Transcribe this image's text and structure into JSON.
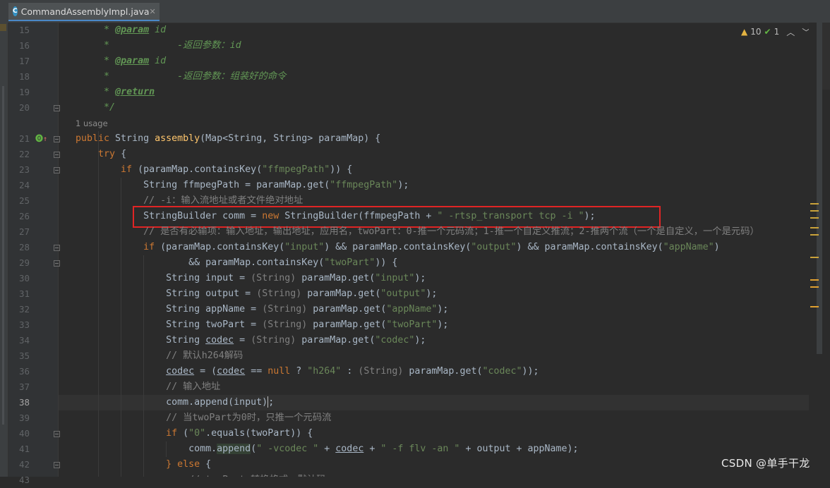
{
  "tab": {
    "icon": "C",
    "title": "CommandAssemblyImpl.java"
  },
  "inspection": {
    "warnings": "10",
    "ok": "1"
  },
  "editor": {
    "usage": "1 usage",
    "current_line": "38",
    "lines": [
      {
        "n": "15",
        "tokens": [
          [
            "    ",
            ""
          ],
          [
            " * ",
            "doc"
          ],
          [
            "@param",
            "tag"
          ],
          [
            " id",
            "doc"
          ]
        ]
      },
      {
        "n": "16",
        "tokens": [
          [
            "     *            -返回参数：id",
            "doc"
          ]
        ]
      },
      {
        "n": "17",
        "tokens": [
          [
            "    ",
            ""
          ],
          [
            " * ",
            "doc"
          ],
          [
            "@param",
            "tag"
          ],
          [
            " id",
            "doc"
          ]
        ]
      },
      {
        "n": "18",
        "tokens": [
          [
            "     *            -返回参数：组装好的命令",
            "doc"
          ]
        ]
      },
      {
        "n": "19",
        "tokens": [
          [
            "    ",
            ""
          ],
          [
            " * ",
            "doc"
          ],
          [
            "@return",
            "tag"
          ]
        ]
      },
      {
        "n": "20",
        "tokens": [
          [
            "     */",
            "doc"
          ]
        ]
      },
      {
        "n": "21",
        "tokens": [
          [
            "public ",
            "kw"
          ],
          [
            "String ",
            ""
          ],
          [
            "assembly",
            "fn"
          ],
          [
            "(Map<String, String> paramMap) {",
            ""
          ]
        ]
      },
      {
        "n": "22",
        "tokens": [
          [
            "    ",
            ""
          ],
          [
            "try ",
            "kw"
          ],
          [
            "{",
            ""
          ]
        ]
      },
      {
        "n": "23",
        "tokens": [
          [
            "        ",
            ""
          ],
          [
            "if ",
            "kw"
          ],
          [
            "(paramMap.containsKey(",
            ""
          ],
          [
            "\"ffmpegPath\"",
            "str"
          ],
          [
            ")) {",
            ""
          ]
        ]
      },
      {
        "n": "24",
        "tokens": [
          [
            "            String ffmpegPath = paramMap.get(",
            ""
          ],
          [
            "\"ffmpegPath\"",
            "str"
          ],
          [
            ");",
            ""
          ]
        ]
      },
      {
        "n": "25",
        "tokens": [
          [
            "            ",
            ""
          ],
          [
            "// -i：输入流地址或者文件绝对地址",
            "cm"
          ]
        ]
      },
      {
        "n": "26",
        "tokens": [
          [
            "            StringBuilder comm = ",
            ""
          ],
          [
            "new ",
            "kw"
          ],
          [
            "StringBuilder(ffmpegPath + ",
            ""
          ],
          [
            "\" -rtsp_transport tcp -i \"",
            "str"
          ],
          [
            ");",
            ""
          ]
        ]
      },
      {
        "n": "27",
        "tokens": [
          [
            "            ",
            ""
          ],
          [
            "// 是否有必输项：输入地址，输出地址，应用名，twoPart：0-推一个元码流；1-推一个自定义推流；2-推两个流（一个是自定义，一个是元码）",
            "cm"
          ]
        ]
      },
      {
        "n": "28",
        "tokens": [
          [
            "            ",
            ""
          ],
          [
            "if ",
            "kw"
          ],
          [
            "(paramMap.containsKey(",
            ""
          ],
          [
            "\"input\"",
            "str"
          ],
          [
            ") && paramMap.containsKey(",
            ""
          ],
          [
            "\"output\"",
            "str"
          ],
          [
            ") && paramMap.containsKey(",
            ""
          ],
          [
            "\"appName\"",
            "str"
          ],
          [
            ")",
            ""
          ]
        ]
      },
      {
        "n": "29",
        "tokens": [
          [
            "                    && paramMap.containsKey(",
            ""
          ],
          [
            "\"twoPart\"",
            "str"
          ],
          [
            ")) {",
            ""
          ]
        ]
      },
      {
        "n": "30",
        "tokens": [
          [
            "                String input = ",
            ""
          ],
          [
            "(String) ",
            "cast"
          ],
          [
            "paramMap.get(",
            ""
          ],
          [
            "\"input\"",
            "str"
          ],
          [
            ");",
            ""
          ]
        ]
      },
      {
        "n": "31",
        "tokens": [
          [
            "                String output = ",
            ""
          ],
          [
            "(String) ",
            "cast"
          ],
          [
            "paramMap.get(",
            ""
          ],
          [
            "\"output\"",
            "str"
          ],
          [
            ");",
            ""
          ]
        ]
      },
      {
        "n": "32",
        "tokens": [
          [
            "                String appName = ",
            ""
          ],
          [
            "(String) ",
            "cast"
          ],
          [
            "paramMap.get(",
            ""
          ],
          [
            "\"appName\"",
            "str"
          ],
          [
            ");",
            ""
          ]
        ]
      },
      {
        "n": "33",
        "tokens": [
          [
            "                String twoPart = ",
            ""
          ],
          [
            "(String) ",
            "cast"
          ],
          [
            "paramMap.get(",
            ""
          ],
          [
            "\"twoPart\"",
            "str"
          ],
          [
            ");",
            ""
          ]
        ]
      },
      {
        "n": "34",
        "tokens": [
          [
            "                String ",
            ""
          ],
          [
            "codec",
            "ul"
          ],
          [
            " = ",
            ""
          ],
          [
            "(String) ",
            "cast"
          ],
          [
            "paramMap.get(",
            ""
          ],
          [
            "\"codec\"",
            "str"
          ],
          [
            ");",
            ""
          ]
        ]
      },
      {
        "n": "35",
        "tokens": [
          [
            "                ",
            ""
          ],
          [
            "// 默认h264解码",
            "cm"
          ]
        ]
      },
      {
        "n": "36",
        "tokens": [
          [
            "                ",
            ""
          ],
          [
            "codec",
            "ul"
          ],
          [
            " = (",
            ""
          ],
          [
            "codec",
            "ul"
          ],
          [
            " == ",
            ""
          ],
          [
            "null ",
            "kw"
          ],
          [
            "? ",
            ""
          ],
          [
            "\"h264\" ",
            "str"
          ],
          [
            ": ",
            ""
          ],
          [
            "(String) ",
            "cast"
          ],
          [
            "paramMap.get(",
            ""
          ],
          [
            "\"codec\"",
            "str"
          ],
          [
            "));",
            ""
          ]
        ]
      },
      {
        "n": "37",
        "tokens": [
          [
            "                ",
            ""
          ],
          [
            "// 输入地址",
            "cm"
          ]
        ]
      },
      {
        "n": "38",
        "tokens": [
          [
            "                comm.append(input);",
            ""
          ]
        ]
      },
      {
        "n": "39",
        "tokens": [
          [
            "                ",
            ""
          ],
          [
            "// 当twoPart为0时，只推一个元码流",
            "cm"
          ]
        ]
      },
      {
        "n": "40",
        "tokens": [
          [
            "                ",
            ""
          ],
          [
            "if ",
            "kw"
          ],
          [
            "(",
            ""
          ],
          [
            "\"0\"",
            "str"
          ],
          [
            ".equals(twoPart)) {",
            ""
          ]
        ]
      },
      {
        "n": "41",
        "tokens": [
          [
            "                    comm.",
            ""
          ],
          [
            "append",
            "hl"
          ],
          [
            "(",
            ""
          ],
          [
            "\" -vcodec \"",
            "str"
          ],
          [
            " + ",
            ""
          ],
          [
            "codec",
            "ul"
          ],
          [
            " + ",
            ""
          ],
          [
            "\" -f flv -an \"",
            "str"
          ],
          [
            " + output + appName);",
            ""
          ]
        ]
      },
      {
        "n": "42",
        "tokens": [
          [
            "                ",
            ""
          ],
          [
            "} ",
            "kw"
          ],
          [
            "else ",
            "kw"
          ],
          [
            "{",
            ""
          ]
        ]
      },
      {
        "n": "43",
        "tokens": [
          [
            "                    ",
            ""
          ],
          [
            "// twoPart 转换格式，默认码",
            "cm"
          ]
        ]
      }
    ]
  },
  "watermark": "CSDN @单手干龙"
}
